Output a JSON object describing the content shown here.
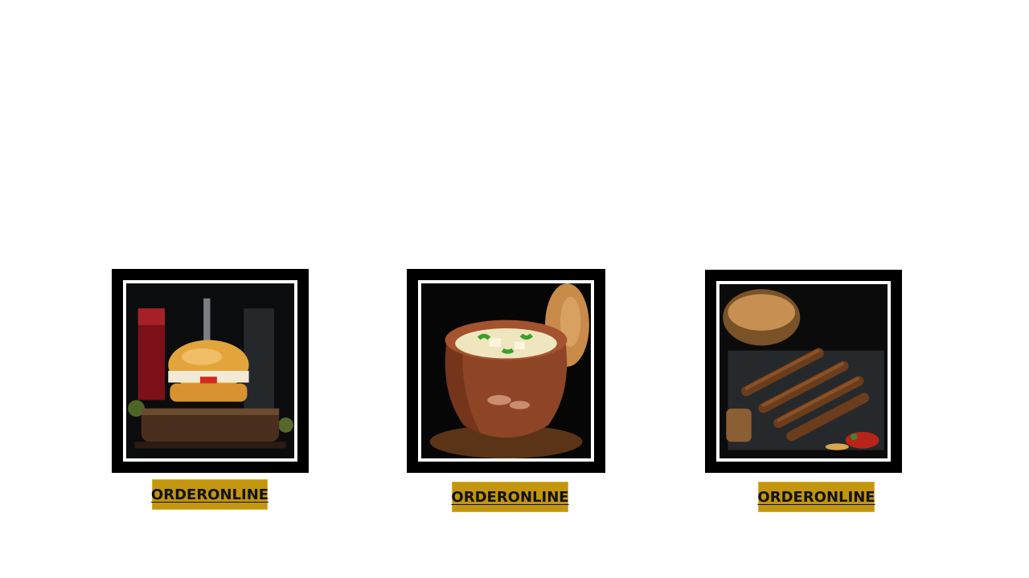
{
  "menu": {
    "items": [
      {
        "image": "burger-image",
        "order_label": "ORDERONLINE"
      },
      {
        "image": "curry-pot-image",
        "order_label": "ORDERONLINE"
      },
      {
        "image": "kebab-skewers-image",
        "order_label": "ORDERONLINE"
      }
    ]
  },
  "colors": {
    "button_background": "#c2960e",
    "frame": "#000000",
    "frame_border": "#ffffff",
    "page_background": "#ffffff"
  }
}
